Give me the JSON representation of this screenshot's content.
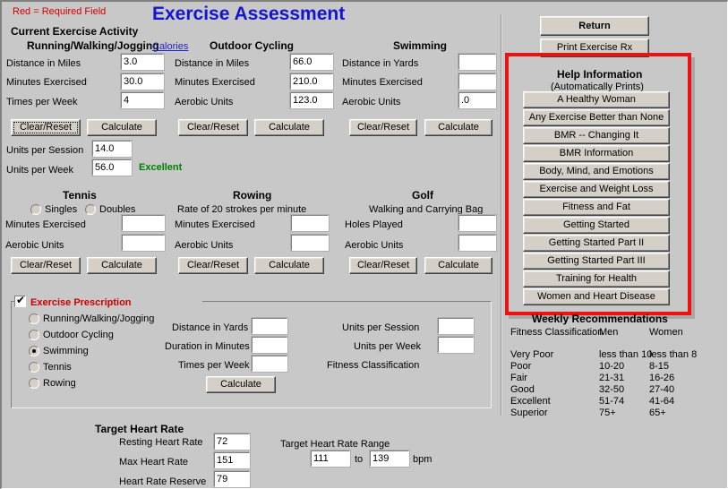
{
  "window": {
    "title": "Exercise Assessment"
  },
  "header": {
    "required_note": "Red = Required Field",
    "title": "Exercise Assessment",
    "current_activity": "Current Exercise Activity"
  },
  "running": {
    "heading": "Running/Walking/Jogging",
    "calories_link": "Calories",
    "fields": [
      {
        "label": "Distance in Miles",
        "value": "3.0"
      },
      {
        "label": "Minutes Exercised",
        "value": "30.0"
      },
      {
        "label": "Times per Week",
        "value": "4"
      }
    ],
    "clear_label": "Clear/Reset",
    "calculate_label": "Calculate",
    "units_session_label": "Units per Session",
    "units_session_value": "14.0",
    "units_week_label": "Units per Week",
    "units_week_value": "56.0",
    "classification": "Excellent"
  },
  "cycling": {
    "heading": "Outdoor Cycling",
    "fields": [
      {
        "label": "Distance in Miles",
        "value": "66.0"
      },
      {
        "label": "Minutes Exercised",
        "value": "210.0"
      },
      {
        "label": "Aerobic Units",
        "value": "123.0"
      }
    ],
    "clear_label": "Clear/Reset",
    "calculate_label": "Calculate"
  },
  "swimming": {
    "heading": "Swimming",
    "fields": [
      {
        "label": "Distance in Yards",
        "value": ""
      },
      {
        "label": "Minutes Exercised",
        "value": ""
      },
      {
        "label": "Aerobic Units",
        "value": ".0"
      }
    ],
    "clear_label": "Clear/Reset",
    "calculate_label": "Calculate"
  },
  "tennis": {
    "heading": "Tennis",
    "singles_label": "Singles",
    "doubles_label": "Doubles",
    "singles_selected": false,
    "doubles_selected": false,
    "fields": [
      {
        "label": "Minutes Exercised",
        "value": ""
      },
      {
        "label": "Aerobic Units",
        "value": ""
      }
    ],
    "clear_label": "Clear/Reset",
    "calculate_label": "Calculate"
  },
  "rowing": {
    "heading": "Rowing",
    "subheading": "Rate of 20 strokes per minute",
    "fields": [
      {
        "label": "Minutes Exercised",
        "value": ""
      },
      {
        "label": "Aerobic Units",
        "value": ""
      }
    ],
    "clear_label": "Clear/Reset",
    "calculate_label": "Calculate"
  },
  "golf": {
    "heading": "Golf",
    "subheading": "Walking and Carrying Bag",
    "fields": [
      {
        "label": "Holes Played",
        "value": ""
      },
      {
        "label": "Aerobic Units",
        "value": ""
      }
    ],
    "clear_label": "Clear/Reset",
    "calculate_label": "Calculate"
  },
  "prescription": {
    "group_label": "Exercise Prescription",
    "checked": true,
    "options": [
      {
        "label": "Running/Walking/Jogging",
        "selected": false
      },
      {
        "label": "Outdoor Cycling",
        "selected": false
      },
      {
        "label": "Swimming",
        "selected": true
      },
      {
        "label": "Tennis",
        "selected": false
      },
      {
        "label": "Rowing",
        "selected": false
      }
    ],
    "left_fields": [
      {
        "label": "Distance in Yards",
        "value": ""
      },
      {
        "label": "Duration in Minutes",
        "value": ""
      },
      {
        "label": "Times per Week",
        "value": ""
      }
    ],
    "right_fields": [
      {
        "label": "Units per Session",
        "value": ""
      },
      {
        "label": "Units per Week",
        "value": ""
      }
    ],
    "fitness_classification_label": "Fitness Classification",
    "fitness_classification_value": "",
    "calculate_label": "Calculate"
  },
  "heart": {
    "heading": "Target Heart Rate",
    "fields": [
      {
        "label": "Resting Heart Rate",
        "value": "72"
      },
      {
        "label": "Max Heart Rate",
        "value": "151"
      },
      {
        "label": "Heart Rate Reserve",
        "value": "79"
      }
    ],
    "range_label": "Target Heart Rate Range",
    "range_low": "111",
    "range_to": "to",
    "range_high": "139",
    "range_unit": "bpm"
  },
  "right_panel": {
    "return_label": "Return",
    "print_label": "Print Exercise Rx",
    "help_title": "Help Information",
    "help_subtitle": "(Automatically Prints)",
    "help_buttons": [
      "A Healthy Woman",
      "Any Exercise Better than None",
      "BMR -- Changing It",
      "BMR Information",
      "Body, Mind, and Emotions",
      "Exercise and Weight Loss",
      "Fitness and Fat",
      "Getting Started",
      "Getting Started Part II",
      "Getting Started Part III",
      "Training for Health",
      "Women and Heart Disease"
    ],
    "highlight_color": "#ee1111"
  },
  "recommendations": {
    "title": "Weekly Recommendations",
    "columns": [
      "Fitness Classification",
      "Men",
      "Women"
    ],
    "rows": [
      [
        "Very Poor",
        "less than 10",
        "less than 8"
      ],
      [
        "Poor",
        "10-20",
        "8-15"
      ],
      [
        "Fair",
        "21-31",
        "16-26"
      ],
      [
        "Good",
        "32-50",
        "27-40"
      ],
      [
        "Excellent",
        "51-74",
        "41-64"
      ],
      [
        "Superior",
        "75+",
        "65+"
      ]
    ]
  }
}
